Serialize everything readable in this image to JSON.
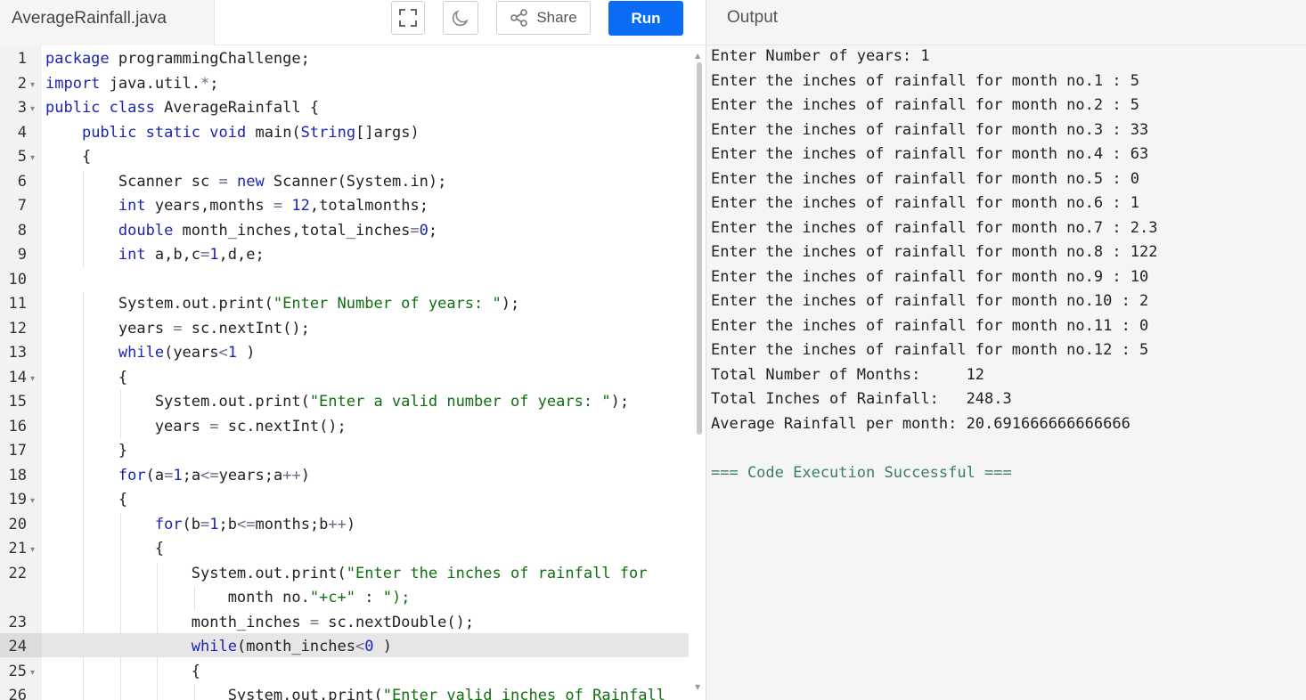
{
  "file_tab": {
    "name": "AverageRainfall.java"
  },
  "toolbar": {
    "share_label": "Share",
    "run_label": "Run"
  },
  "output_panel": {
    "title": "Output"
  },
  "editor": {
    "active_line": 24,
    "lines": [
      {
        "n": "1",
        "fold": false,
        "text": "package programmingChallenge;"
      },
      {
        "n": "2",
        "fold": true,
        "text": "import java.util.*;"
      },
      {
        "n": "3",
        "fold": true,
        "text": "public class AverageRainfall {"
      },
      {
        "n": "4",
        "fold": false,
        "text": "    public static void main(String[]args)"
      },
      {
        "n": "5",
        "fold": true,
        "text": "    {"
      },
      {
        "n": "6",
        "fold": false,
        "text": "        Scanner sc = new Scanner(System.in);"
      },
      {
        "n": "7",
        "fold": false,
        "text": "        int years,months = 12,totalmonths;"
      },
      {
        "n": "8",
        "fold": false,
        "text": "        double month_inches,total_inches=0;"
      },
      {
        "n": "9",
        "fold": false,
        "text": "        int a,b,c=1,d,e;"
      },
      {
        "n": "10",
        "fold": false,
        "text": ""
      },
      {
        "n": "11",
        "fold": false,
        "text": "        System.out.print(\"Enter Number of years: \");"
      },
      {
        "n": "12",
        "fold": false,
        "text": "        years = sc.nextInt();"
      },
      {
        "n": "13",
        "fold": false,
        "text": "        while(years<1 )"
      },
      {
        "n": "14",
        "fold": true,
        "text": "        {"
      },
      {
        "n": "15",
        "fold": false,
        "text": "            System.out.print(\"Enter a valid number of years: \");"
      },
      {
        "n": "16",
        "fold": false,
        "text": "            years = sc.nextInt();"
      },
      {
        "n": "17",
        "fold": false,
        "text": "        }"
      },
      {
        "n": "18",
        "fold": false,
        "text": "        for(a=1;a<=years;a++)"
      },
      {
        "n": "19",
        "fold": true,
        "text": "        {"
      },
      {
        "n": "20",
        "fold": false,
        "text": "            for(b=1;b<=months;b++)"
      },
      {
        "n": "21",
        "fold": true,
        "text": "            {"
      },
      {
        "n": "22",
        "fold": false,
        "text": "                System.out.print(\"Enter the inches of rainfall for"
      },
      {
        "n": "",
        "fold": false,
        "text": "                    month no.\"+c+\" : \");"
      },
      {
        "n": "23",
        "fold": false,
        "text": "                month_inches = sc.nextDouble();"
      },
      {
        "n": "24",
        "fold": false,
        "text": "                while(month_inches<0 )"
      },
      {
        "n": "25",
        "fold": true,
        "text": "                {"
      },
      {
        "n": "26",
        "fold": false,
        "text": "                    System.out.print(\"Enter valid inches of Rainfall"
      }
    ]
  },
  "output": {
    "lines": [
      "Enter Number of years: 1",
      "Enter the inches of rainfall for month no.1 : 5",
      "Enter the inches of rainfall for month no.2 : 5",
      "Enter the inches of rainfall for month no.3 : 33",
      "Enter the inches of rainfall for month no.4 : 63",
      "Enter the inches of rainfall for month no.5 : 0",
      "Enter the inches of rainfall for month no.6 : 1",
      "Enter the inches of rainfall for month no.7 : 2.3",
      "Enter the inches of rainfall for month no.8 : 122",
      "Enter the inches of rainfall for month no.9 : 10",
      "Enter the inches of rainfall for month no.10 : 2",
      "Enter the inches of rainfall for month no.11 : 0",
      "Enter the inches of rainfall for month no.12 : 5",
      "Total Number of Months:     12",
      "Total Inches of Rainfall:   248.3",
      "Average Rainfall per month: 20.691666666666666",
      "",
      "=== Code Execution Successful ==="
    ]
  },
  "colors": {
    "run_button": "#0a6cf5",
    "keyword": "#1b24b3",
    "string": "#106e10",
    "success": "#3c7d5c"
  }
}
